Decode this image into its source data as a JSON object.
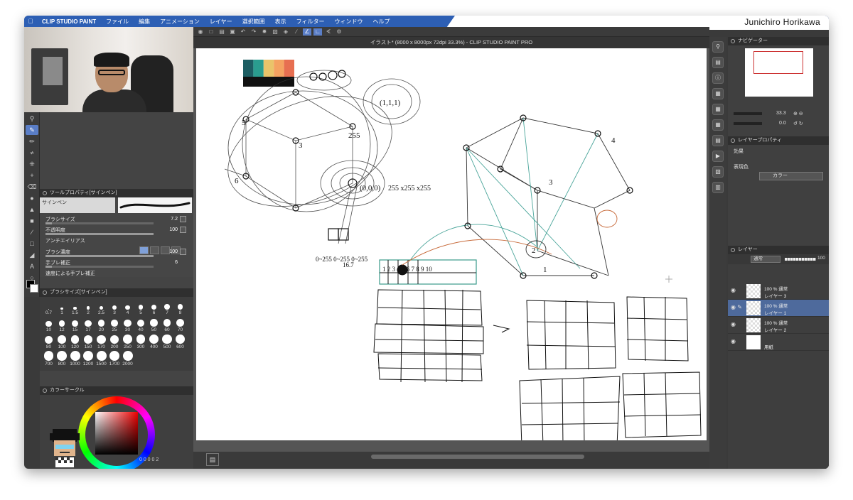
{
  "menubar": {
    "app_name": "CLIP STUDIO PAINT",
    "items": [
      "ファイル",
      "編集",
      "アニメーション",
      "レイヤー",
      "選択範囲",
      "表示",
      "フィルター",
      "ウィンドウ",
      "ヘルプ"
    ]
  },
  "streamer": {
    "name": "Junichiro Horikawa"
  },
  "document": {
    "title": "イラスト* (8000 x 8000px 72dpi 33.3%) - CLIP STUDIO PAINT PRO"
  },
  "tool_property": {
    "header": "ツールプロパティ[サインペン]",
    "brush_name": "サインペン",
    "props": [
      {
        "label": "ブラシサイズ",
        "value": "7.2",
        "fill": 0.06
      },
      {
        "label": "不透明度",
        "value": "100",
        "fill": 1.0
      },
      {
        "label": "アンチエイリアス",
        "value": "",
        "fill": 0
      },
      {
        "label": "ブラシ濃度",
        "value": "100",
        "fill": 1.0
      },
      {
        "label": "手ブレ補正",
        "value": "6",
        "fill": 0.06
      },
      {
        "label": "速度による手ブレ補正",
        "value": "",
        "fill": 0
      }
    ]
  },
  "brush_size": {
    "header": "ブラシサイズ[サインペン]",
    "sizes": [
      "0.7",
      "1",
      "1.5",
      "2",
      "2.5",
      "3",
      "4",
      "5",
      "6",
      "7",
      "8",
      "10",
      "12",
      "15",
      "17",
      "20",
      "25",
      "30",
      "40",
      "50",
      "60",
      "70",
      "80",
      "100",
      "120",
      "150",
      "170",
      "200",
      "250",
      "300",
      "400",
      "500",
      "600",
      "700",
      "800",
      "1000",
      "1200",
      "1500",
      "1700",
      "2000"
    ]
  },
  "color_panel": {
    "header": "カラーサークル",
    "status": "0 0 0 0 2"
  },
  "palette": [
    "#1d5e63",
    "#2a9d8f",
    "#e9c46a",
    "#f4a261",
    "#e76f51"
  ],
  "navigator": {
    "header": "ナビゲーター",
    "zoom": "33.3",
    "rotation": "0.0"
  },
  "layer_property": {
    "header": "レイヤープロパティ",
    "effect_label": "効果",
    "express_color_label": "表現色",
    "express_color_value": "カラー"
  },
  "layers_panel": {
    "header": "レイヤー",
    "blend_mode": "通常",
    "opacity": "100",
    "layers": [
      {
        "mode": "100 % 通常",
        "name": "レイヤー 3",
        "selected": false
      },
      {
        "mode": "100 % 通常",
        "name": "レイヤー 1",
        "selected": true
      },
      {
        "mode": "100 % 通常",
        "name": "レイヤー 2",
        "selected": false
      },
      {
        "mode": "",
        "name": "用紙",
        "selected": false
      }
    ]
  },
  "sketch_labels": {
    "n5": "5",
    "n255_top": "255",
    "n3": "3",
    "n6": "6",
    "n111": "(1,1,1)",
    "n000": "(0,0,0)",
    "formula": "255 x255 x255",
    "range": "0~255 0~255 0~255",
    "count": "16.7",
    "ruler": "1 2 3 4 5 6 7 8 9 10",
    "a4": "4",
    "a3": "3",
    "a2": "2",
    "a1": "1"
  }
}
